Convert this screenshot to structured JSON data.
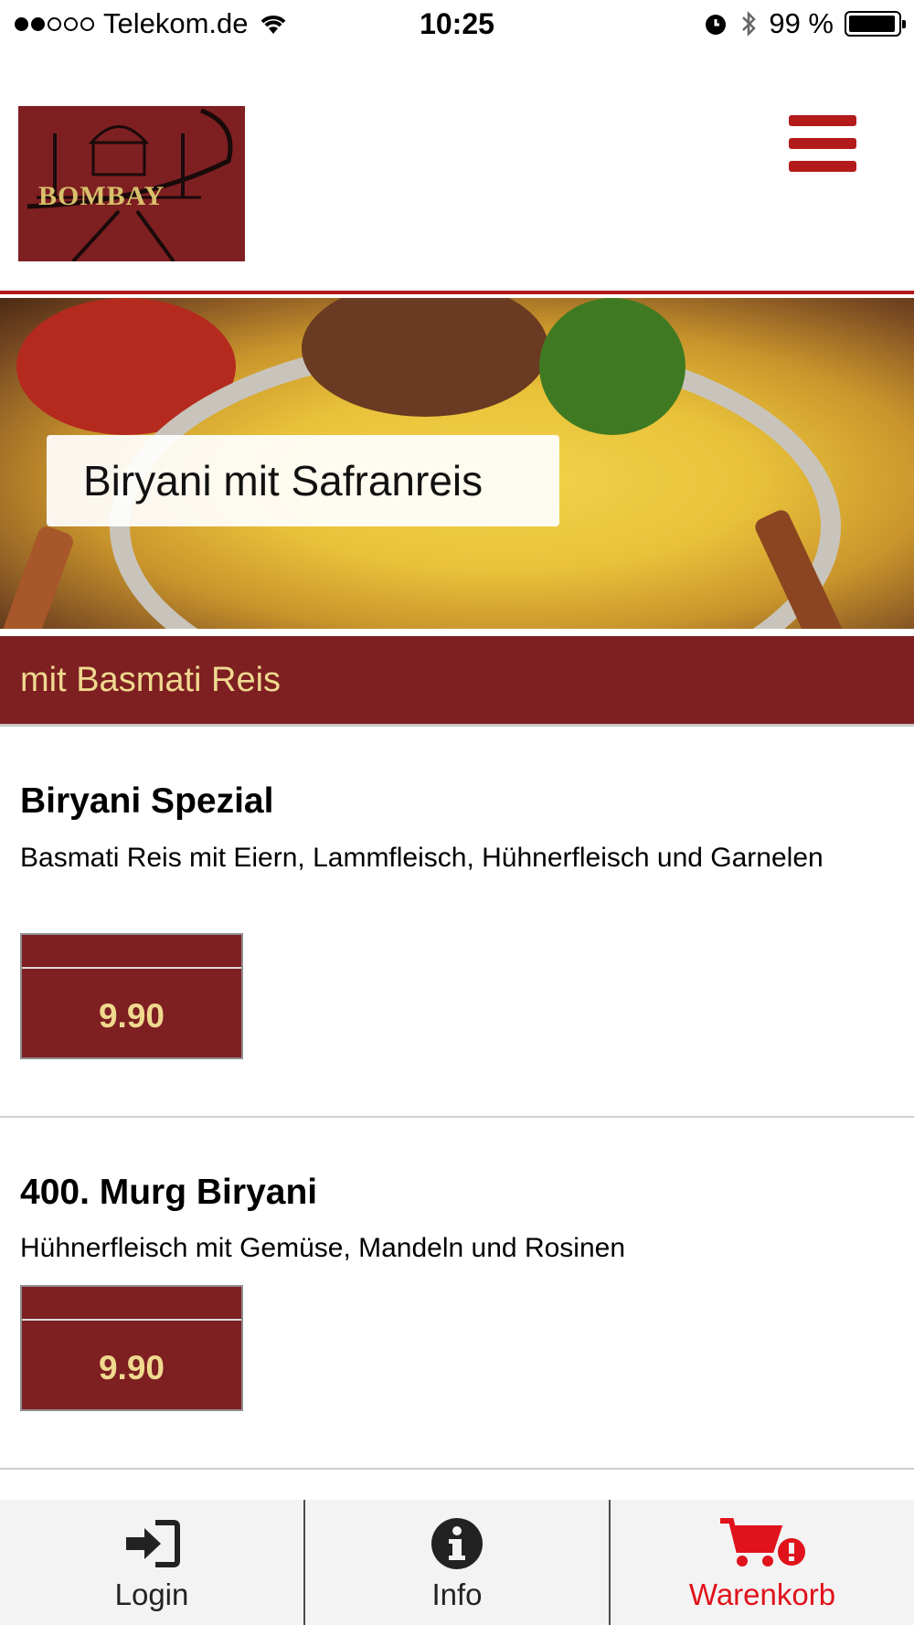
{
  "status_bar": {
    "carrier": "Telekom.de",
    "time": "10:25",
    "battery": "99 %"
  },
  "header": {
    "logo_text": "BOMBAY",
    "menu_icon": "hamburger-menu-icon"
  },
  "hero": {
    "caption": "Biryani mit Safranreis"
  },
  "category": {
    "title": "mit Basmati Reis"
  },
  "items": [
    {
      "title": "Biryani Spezial",
      "description": "Basmati Reis mit Eiern, Lammfleisch, Hühnerfleisch und Garnelen",
      "price": "9.90"
    },
    {
      "title": "400. Murg Biryani",
      "description": "Hühnerfleisch mit Gemüse, Mandeln und Rosinen",
      "price": "9.90"
    }
  ],
  "tabbar": {
    "tabs": [
      {
        "label": "Login",
        "icon": "sign-in-icon"
      },
      {
        "label": "Info",
        "icon": "info-icon"
      },
      {
        "label": "Warenkorb",
        "icon": "shopping-cart-alert-icon"
      }
    ]
  },
  "colors": {
    "brand_red": "#7e1f22",
    "accent_red": "#b31b1b",
    "gold_text": "#f0d98f",
    "active_tab": "#e0121b"
  }
}
